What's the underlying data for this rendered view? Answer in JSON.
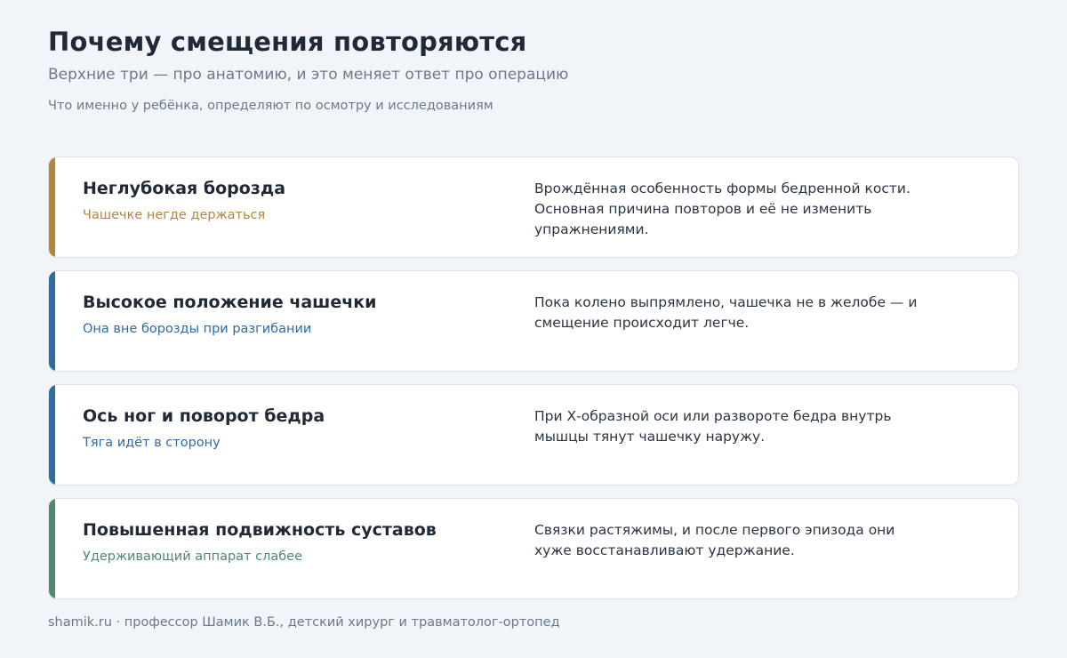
{
  "header": {
    "title": "Почему смещения повторяются",
    "subtitle": "Верхние три — про анатомию, и это меняет ответ про операцию",
    "note": "Что именно у ребёнка, определяют по осмотру и исследованиям"
  },
  "cards": [
    {
      "heading": "Неглубокая борозда",
      "tagline": "Чашечке негде держаться",
      "description": "Врождённая особенность формы бедренной кости. Основная причина повторов и её не изменить упражнениями.",
      "color": "#b5853a"
    },
    {
      "heading": "Высокое положение чашечки",
      "tagline": "Она вне борозды при разгибании",
      "description": "Пока колено выпрямлено, чашечка не в желобе — и смещение происходит легче.",
      "color": "#2f6aa8"
    },
    {
      "heading": "Ось ног и поворот бедра",
      "tagline": "Тяга идёт в сторону",
      "description": "При Х-образной оси или развороте бедра внутрь мышцы тянут чашечку наружу.",
      "color": "#2f6aa8"
    },
    {
      "heading": "Повышенная подвижность суставов",
      "tagline": "Удерживающий аппарат слабее",
      "description": "Связки растяжимы, и после первого эпизода они хуже восстанавливают удержание.",
      "color": "#4e8a6c"
    }
  ],
  "footer": {
    "text": "shamik.ru · профессор Шамик В.Б., детский хирург и травматолог-ортопед"
  }
}
